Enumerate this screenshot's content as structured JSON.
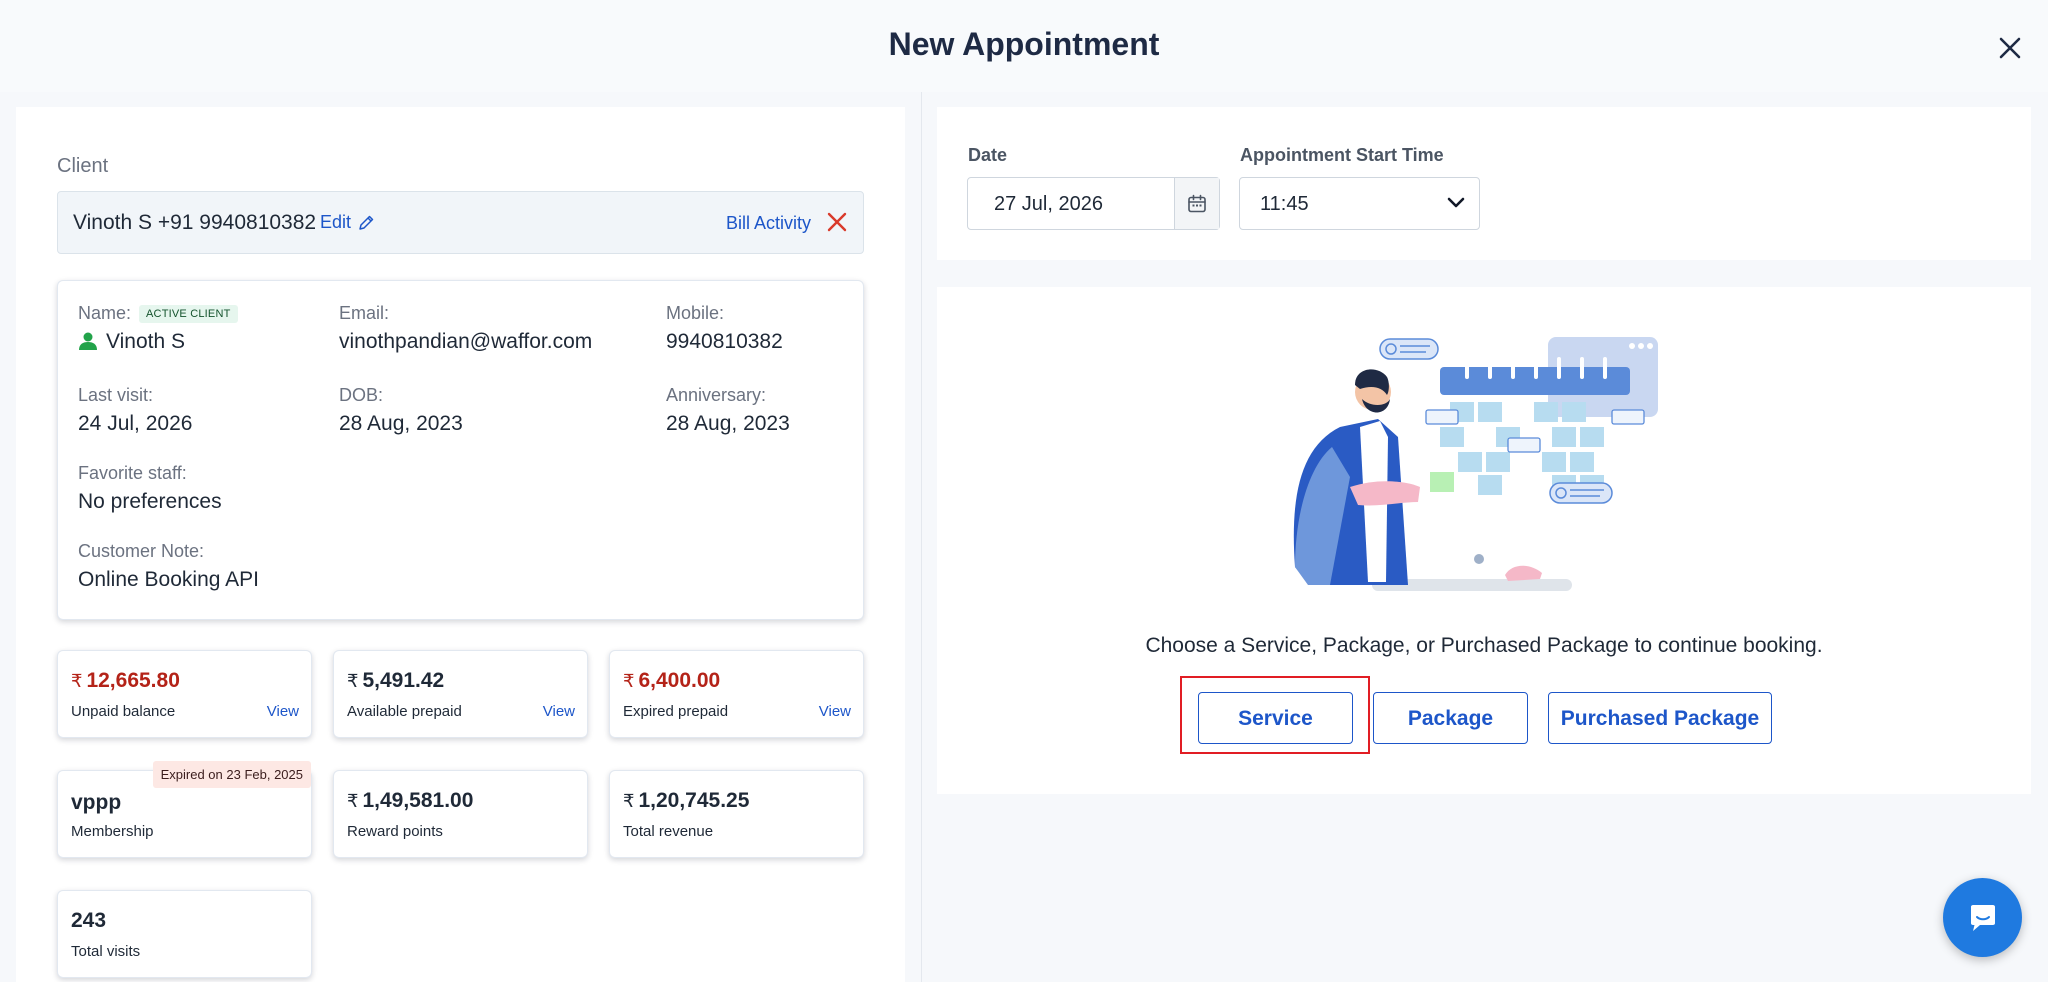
{
  "header": {
    "title": "New Appointment"
  },
  "client": {
    "section_label": "Client",
    "display": "Vinoth S +91 9940810382",
    "edit_label": "Edit",
    "bill_activity_label": "Bill Activity"
  },
  "details": {
    "name_label": "Name:",
    "status_badge": "ACTIVE CLIENT",
    "name": "Vinoth S",
    "email_label": "Email:",
    "email": "vinothpandian@waffor.com",
    "mobile_label": "Mobile:",
    "mobile": "9940810382",
    "last_visit_label": "Last visit:",
    "last_visit": "24 Jul, 2026",
    "dob_label": "DOB:",
    "dob": "28 Aug, 2023",
    "anniversary_label": "Anniversary:",
    "anniversary": "28 Aug, 2023",
    "favorite_staff_label": "Favorite staff:",
    "favorite_staff": "No preferences",
    "customer_note_label": "Customer Note:",
    "customer_note": "Online Booking API"
  },
  "stats": {
    "currency_symbol": "₹",
    "unpaid": {
      "value": "12,665.80",
      "label": "Unpaid balance",
      "link": "View"
    },
    "prepaid": {
      "value": "5,491.42",
      "label": "Available prepaid",
      "link": "View"
    },
    "expired_prepaid": {
      "value": "6,400.00",
      "label": "Expired prepaid",
      "link": "View"
    },
    "membership": {
      "value": "vppp",
      "label": "Membership",
      "tag": "Expired on 23 Feb, 2025"
    },
    "reward": {
      "value": "1,49,581.00",
      "label": "Reward points"
    },
    "revenue": {
      "value": "1,20,745.25",
      "label": "Total revenue"
    },
    "visits": {
      "value": "243",
      "label": "Total visits"
    }
  },
  "booking": {
    "date_label": "Date",
    "date_value": "27 Jul, 2026",
    "time_label": "Appointment Start Time",
    "time_value": "11:45"
  },
  "main": {
    "prompt": "Choose a Service, Package, or Purchased Package to continue booking.",
    "service_label": "Service",
    "package_label": "Package",
    "purchased_label": "Purchased Package"
  },
  "colors": {
    "accent": "#1d56c9",
    "danger": "#b42318",
    "highlight": "#e11d24",
    "fab": "#1f7ae0"
  }
}
